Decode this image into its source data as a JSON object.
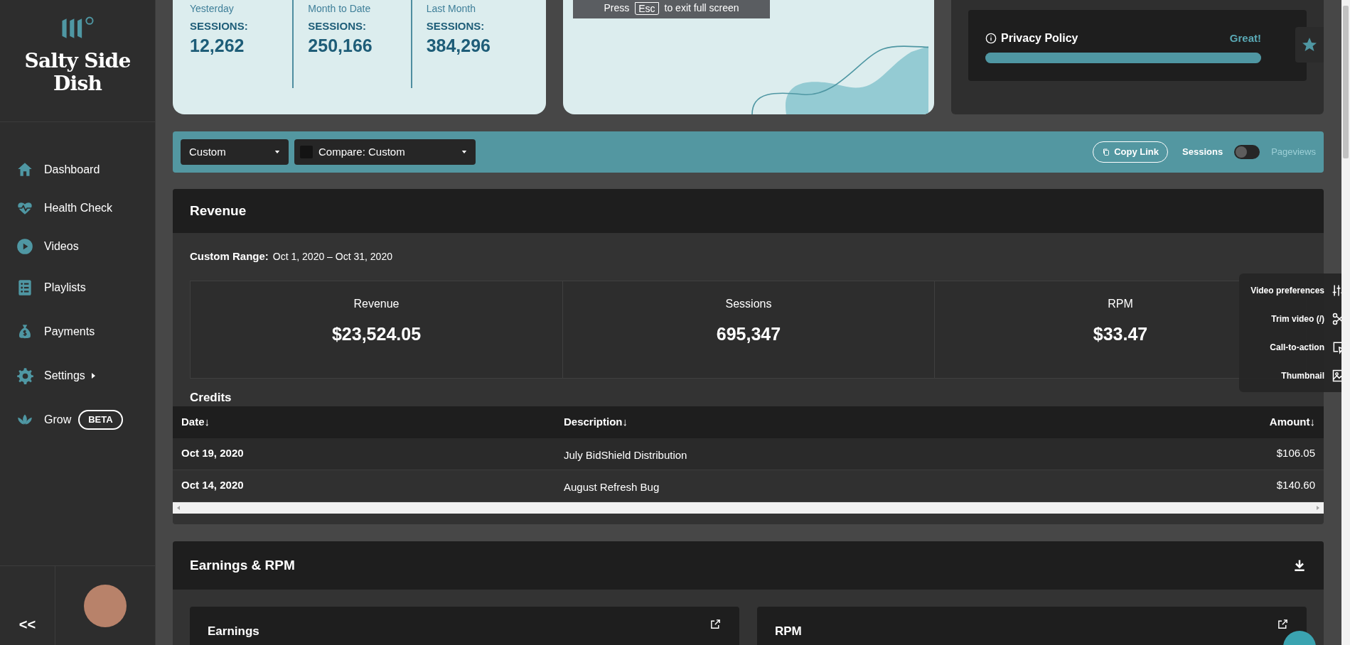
{
  "sidebar": {
    "brand": "Salty Side Dish",
    "items": [
      {
        "label": "Dashboard",
        "submenu": false
      },
      {
        "label": "Health Check",
        "submenu": false
      },
      {
        "label": "Videos",
        "submenu": false
      },
      {
        "label": "Playlists",
        "submenu": false
      },
      {
        "label": "Payments",
        "submenu": false
      },
      {
        "label": "Settings",
        "submenu": true
      },
      {
        "label": "Grow",
        "submenu": false,
        "badge": "BETA"
      }
    ],
    "collapse": "<<"
  },
  "stats": [
    {
      "period": "Yesterday",
      "label": "SESSIONS:",
      "value": "12,262"
    },
    {
      "period": "Month to Date",
      "label": "SESSIONS:",
      "value": "250,166"
    },
    {
      "period": "Last Month",
      "label": "SESSIONS:",
      "value": "384,296"
    }
  ],
  "fullscreen_notice": {
    "before": "Press",
    "key": "Esc",
    "after": "to exit full screen"
  },
  "privacy": {
    "title": "Privacy Policy",
    "status": "Great!",
    "level": 1
  },
  "filters": {
    "range": "Custom",
    "compare": "Compare: Custom",
    "copy_link": "Copy Link",
    "toggle_left": "Sessions",
    "toggle_right": "Pageviews",
    "toggle_on": false
  },
  "revenue": {
    "title": "Revenue",
    "range_label": "Custom Range:",
    "range_value": "Oct 1, 2020 – Oct 31, 2020",
    "metrics": [
      {
        "label": "Revenue",
        "value": "$23,524.05"
      },
      {
        "label": "Sessions",
        "value": "695,347"
      },
      {
        "label": "RPM",
        "value": "$33.47"
      }
    ],
    "credits_title": "Credits",
    "columns": [
      "Date↓",
      "Description↓",
      "Amount↓"
    ],
    "rows": [
      [
        "Oct 19, 2020",
        "July BidShield Distribution",
        "$106.05"
      ],
      [
        "Oct 14, 2020",
        "August Refresh Bug",
        "$140.60"
      ]
    ]
  },
  "video_menu": [
    {
      "label": "Video preferences"
    },
    {
      "label": "Trim video (/)"
    },
    {
      "label": "Call-to-action"
    },
    {
      "label": "Thumbnail"
    }
  ],
  "earnings": {
    "title": "Earnings & RPM",
    "cards": [
      "Earnings",
      "RPM"
    ]
  }
}
